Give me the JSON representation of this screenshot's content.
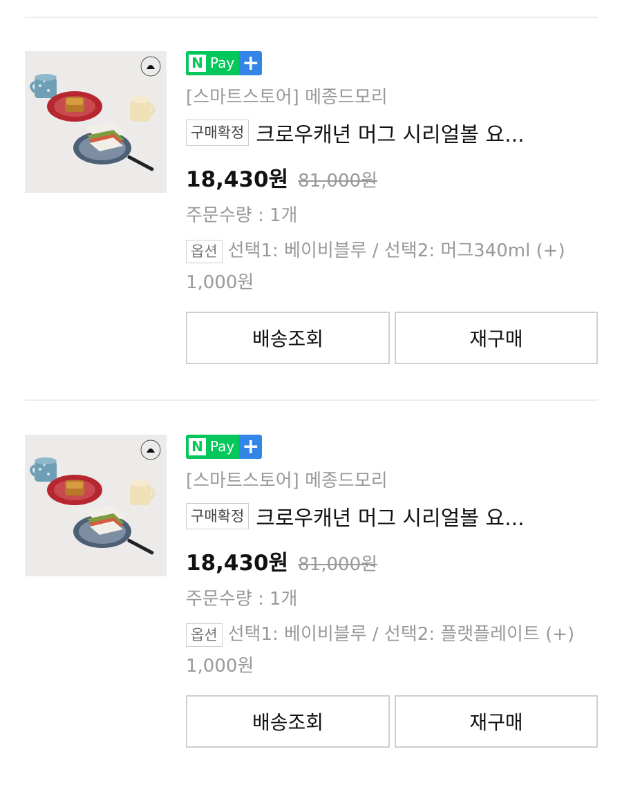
{
  "orders": [
    {
      "npay_label": "Pay",
      "npay_n": "N",
      "npay_plus": "+",
      "store": "[스마트스토어] 메종드모리",
      "status_badge": "구매확정",
      "title": "크로우캐년 머그 시리얼볼 요...",
      "price": "18,430원",
      "original_price": "81,000원",
      "quantity": "주문수량 : 1개",
      "option_badge": "옵션",
      "option_text": "선택1: 베이비블루 / 선택2: 머그340ml (+) 1,000원",
      "buttons": {
        "track": "배송조회",
        "rebuy": "재구매"
      }
    },
    {
      "npay_label": "Pay",
      "npay_n": "N",
      "npay_plus": "+",
      "store": "[스마트스토어] 메종드모리",
      "status_badge": "구매확정",
      "title": "크로우캐년 머그 시리얼볼 요...",
      "price": "18,430원",
      "original_price": "81,000원",
      "quantity": "주문수량 : 1개",
      "option_badge": "옵션",
      "option_text": "선택1: 베이비블루 / 선택2: 플랫플레이트 (+) 1,000원",
      "buttons": {
        "track": "배송조회",
        "rebuy": "재구매"
      }
    }
  ],
  "colors": {
    "npay_green": "#03c75a",
    "npay_blue": "#3385e6",
    "muted_text": "#999999",
    "border": "#d0d0d0"
  },
  "icons": {
    "product_image": "product-thumbnail-image",
    "brand_logo": "crow-logo-icon"
  }
}
